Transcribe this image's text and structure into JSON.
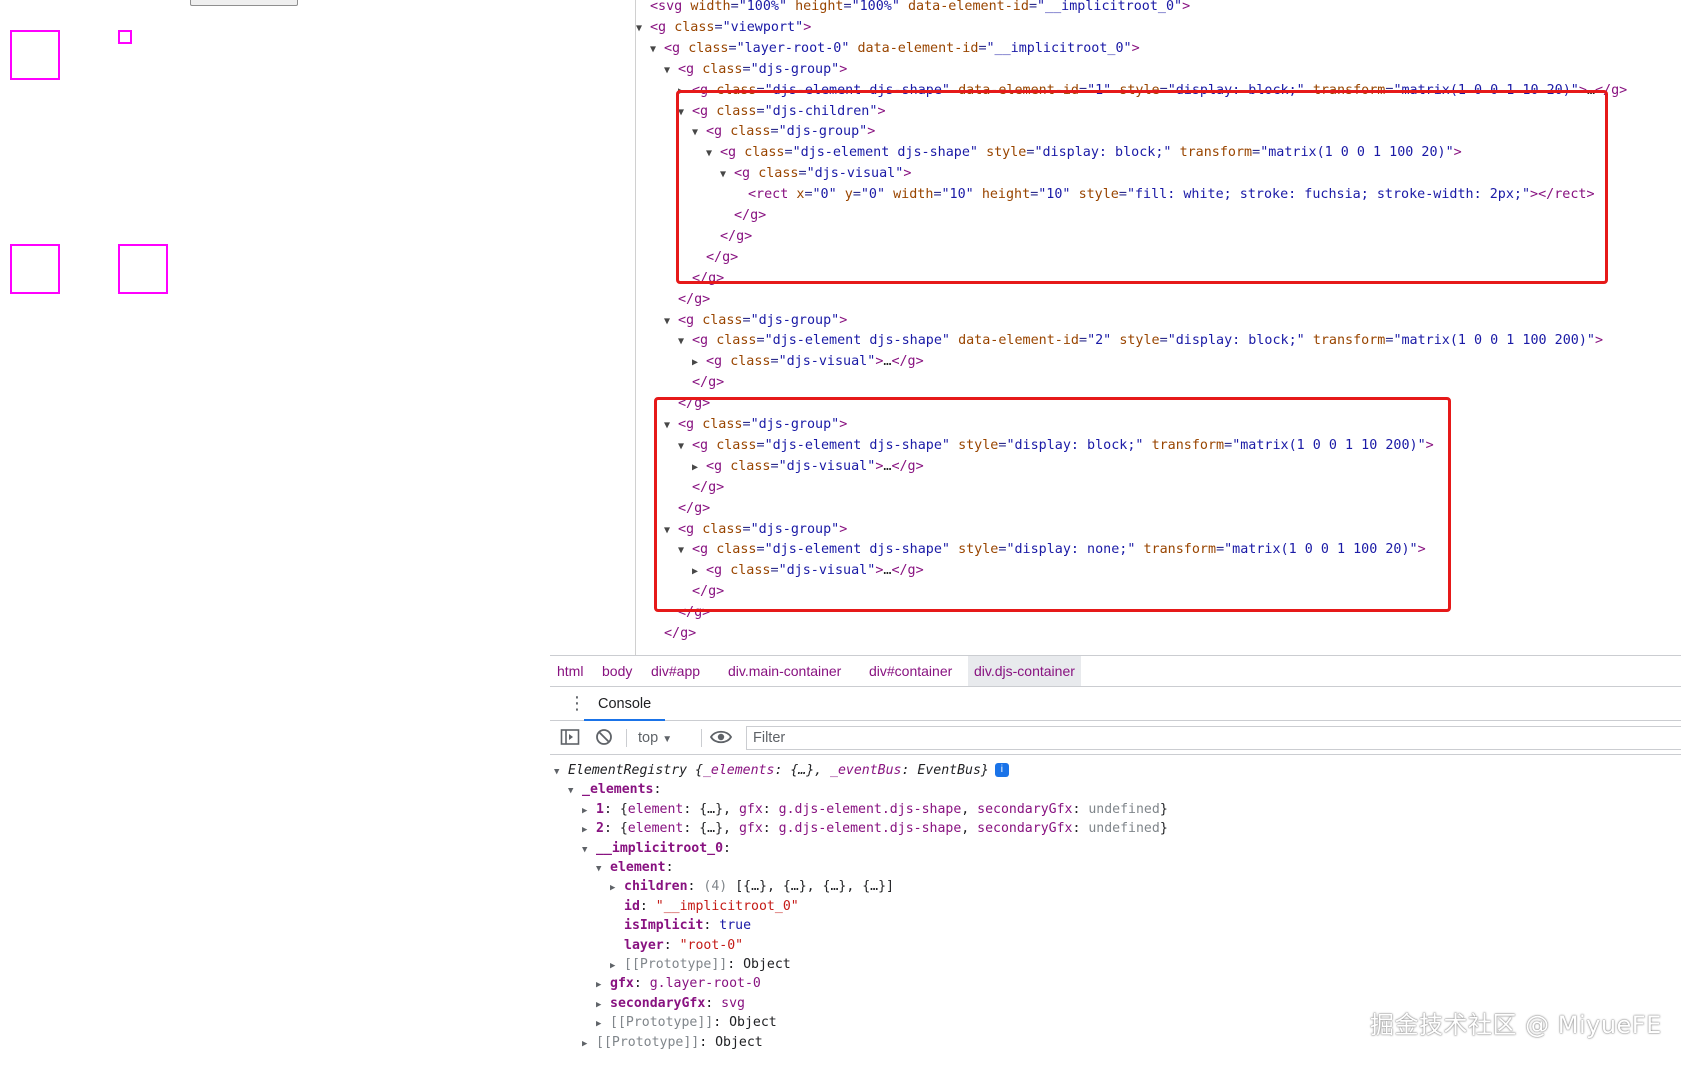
{
  "canvas": {
    "shapes": [
      {
        "name": "shape-square-1"
      },
      {
        "name": "shape-small-square"
      },
      {
        "name": "shape-square-3"
      },
      {
        "name": "shape-square-4"
      }
    ],
    "stroke_color": "#ff00ff"
  },
  "elements_panel": {
    "lines": [
      {
        "d": 0,
        "tri": "",
        "html": "<span class='tag'>&lt;svg</span> <span class='an'>width</span>=<span class='av'>\"100%\"</span> <span class='an'>height</span>=<span class='av'>\"100%\"</span> <span class='an'>data-element-id</span>=<span class='av'>\"__implicitroot_0\"</span><span class='tag'>&gt;</span>"
      },
      {
        "d": 0,
        "tri": "▼",
        "html": "<span class='tag'>&lt;g</span> <span class='an'>class</span>=<span class='av'>\"viewport\"</span><span class='tag'>&gt;</span>"
      },
      {
        "d": 1,
        "tri": "▼",
        "html": "<span class='tag'>&lt;g</span> <span class='an'>class</span>=<span class='av'>\"layer-root-0\"</span> <span class='an'>data-element-id</span>=<span class='av'>\"__implicitroot_0\"</span><span class='tag'>&gt;</span>"
      },
      {
        "d": 2,
        "tri": "▼",
        "html": "<span class='tag'>&lt;g</span> <span class='an'>class</span>=<span class='av'>\"djs-group\"</span><span class='tag'>&gt;</span>"
      },
      {
        "d": 3,
        "tri": "▶",
        "html": "<span class='tag'>&lt;g</span> <span class='an'>class</span>=<span class='av'>\"djs-element djs-shape\"</span> <span class='an'>data-element-id</span>=<span class='av'>\"1\"</span> <span class='an'>style</span>=<span class='av'>\"display: block;\"</span> <span class='an'>transform</span>=<span class='av'>\"matrix(1 0 0 1 10 20)\"</span><span class='tag'>&gt;</span><span class='txt'>…</span><span class='tag'>&lt;/g&gt;</span>"
      },
      {
        "d": 3,
        "tri": "▼",
        "html": "<span class='tag'>&lt;g</span> <span class='an'>class</span>=<span class='av'>\"djs-children\"</span><span class='tag'>&gt;</span>"
      },
      {
        "d": 4,
        "tri": "▼",
        "html": "<span class='tag'>&lt;g</span> <span class='an'>class</span>=<span class='av'>\"djs-group\"</span><span class='tag'>&gt;</span>"
      },
      {
        "d": 5,
        "tri": "▼",
        "html": "<span class='tag'>&lt;g</span> <span class='an'>class</span>=<span class='av'>\"djs-element djs-shape\"</span> <span class='an'>style</span>=<span class='av'>\"display: block;\"</span> <span class='an'>transform</span>=<span class='av'>\"matrix(1 0 0 1 100 20)\"</span><span class='tag'>&gt;</span>"
      },
      {
        "d": 6,
        "tri": "▼",
        "html": "<span class='tag'>&lt;g</span> <span class='an'>class</span>=<span class='av'>\"djs-visual\"</span><span class='tag'>&gt;</span>"
      },
      {
        "d": 7,
        "tri": "",
        "html": "<span class='tag'>&lt;rect</span> <span class='an'>x</span>=<span class='av'>\"0\"</span> <span class='an'>y</span>=<span class='av'>\"0\"</span> <span class='an'>width</span>=<span class='av'>\"10\"</span> <span class='an'>height</span>=<span class='av'>\"10\"</span> <span class='an'>style</span>=<span class='av'>\"fill: white; stroke: fuchsia; stroke-width: 2px;\"</span><span class='tag'>&gt;&lt;/rect&gt;</span>"
      },
      {
        "d": 6,
        "tri": "",
        "html": "<span class='tag'>&lt;/g&gt;</span>"
      },
      {
        "d": 5,
        "tri": "",
        "html": "<span class='tag'>&lt;/g&gt;</span>"
      },
      {
        "d": 4,
        "tri": "",
        "html": "<span class='tag'>&lt;/g&gt;</span>"
      },
      {
        "d": 3,
        "tri": "",
        "html": "<span class='tag'>&lt;/g&gt;</span>"
      },
      {
        "d": 2,
        "tri": "",
        "html": "<span class='tag'>&lt;/g&gt;</span>"
      },
      {
        "d": 2,
        "tri": "▼",
        "html": "<span class='tag'>&lt;g</span> <span class='an'>class</span>=<span class='av'>\"djs-group\"</span><span class='tag'>&gt;</span>"
      },
      {
        "d": 3,
        "tri": "▼",
        "html": "<span class='tag'>&lt;g</span> <span class='an'>class</span>=<span class='av'>\"djs-element djs-shape\"</span> <span class='an'>data-element-id</span>=<span class='av'>\"2\"</span> <span class='an'>style</span>=<span class='av'>\"display: block;\"</span> <span class='an'>transform</span>=<span class='av'>\"matrix(1 0 0 1 100 200)\"</span><span class='tag'>&gt;</span>"
      },
      {
        "d": 4,
        "tri": "▶",
        "html": "<span class='tag'>&lt;g</span> <span class='an'>class</span>=<span class='av'>\"djs-visual\"</span><span class='tag'>&gt;</span><span class='txt'>…</span><span class='tag'>&lt;/g&gt;</span>"
      },
      {
        "d": 3,
        "tri": "",
        "html": "<span class='tag'>&lt;/g&gt;</span>"
      },
      {
        "d": 2,
        "tri": "",
        "html": "<span class='tag'>&lt;/g&gt;</span>"
      },
      {
        "d": 2,
        "tri": "▼",
        "html": "<span class='tag'>&lt;g</span> <span class='an'>class</span>=<span class='av'>\"djs-group\"</span><span class='tag'>&gt;</span>"
      },
      {
        "d": 3,
        "tri": "▼",
        "html": "<span class='tag'>&lt;g</span> <span class='an'>class</span>=<span class='av'>\"djs-element djs-shape\"</span> <span class='an'>style</span>=<span class='av'>\"display: block;\"</span> <span class='an'>transform</span>=<span class='av'>\"matrix(1 0 0 1 10 200)\"</span><span class='tag'>&gt;</span>"
      },
      {
        "d": 4,
        "tri": "▶",
        "html": "<span class='tag'>&lt;g</span> <span class='an'>class</span>=<span class='av'>\"djs-visual\"</span><span class='tag'>&gt;</span><span class='txt'>…</span><span class='tag'>&lt;/g&gt;</span>"
      },
      {
        "d": 3,
        "tri": "",
        "html": "<span class='tag'>&lt;/g&gt;</span>"
      },
      {
        "d": 2,
        "tri": "",
        "html": "<span class='tag'>&lt;/g&gt;</span>"
      },
      {
        "d": 2,
        "tri": "▼",
        "html": "<span class='tag'>&lt;g</span> <span class='an'>class</span>=<span class='av'>\"djs-group\"</span><span class='tag'>&gt;</span>"
      },
      {
        "d": 3,
        "tri": "▼",
        "html": "<span class='tag'>&lt;g</span> <span class='an'>class</span>=<span class='av'>\"djs-element djs-shape\"</span> <span class='an'>style</span>=<span class='av'>\"display: none;\"</span> <span class='an'>transform</span>=<span class='av'>\"matrix(1 0 0 1 100 20)\"</span><span class='tag'>&gt;</span>"
      },
      {
        "d": 4,
        "tri": "▶",
        "html": "<span class='tag'>&lt;g</span> <span class='an'>class</span>=<span class='av'>\"djs-visual\"</span><span class='tag'>&gt;</span><span class='txt'>…</span><span class='tag'>&lt;/g&gt;</span>"
      },
      {
        "d": 3,
        "tri": "",
        "html": "<span class='tag'>&lt;/g&gt;</span>"
      },
      {
        "d": 2,
        "tri": "",
        "html": "<span class='tag'>&lt;/g&gt;</span>"
      },
      {
        "d": 1,
        "tri": "",
        "html": "<span class='tag'>&lt;/g&gt;</span>"
      }
    ],
    "highlight_color": "#e61919"
  },
  "breadcrumbs": [
    "html",
    "body",
    "div#app",
    "div.main-container",
    "div#container",
    "div.djs-container"
  ],
  "drawer": {
    "tab_label": "Console",
    "context_label": "top",
    "filter_placeholder": "Filter"
  },
  "console": {
    "lines": [
      {
        "d": 0,
        "tri": "▼",
        "html": "<span class='it'>ElementRegistry {<span class='keyn'>_elements</span>: {…}, <span class='keyn'>_eventBus</span>: EventBus}</span><span class='info-icon'>i</span>"
      },
      {
        "d": 1,
        "tri": "▼",
        "html": "<span class='key'>_elements</span>:"
      },
      {
        "d": 2,
        "tri": "▶",
        "html": "<span class='key'>1</span>: {<span class='keyn'>element</span>: {…}, <span class='keyn'>gfx</span>: <span class='val-elem'>g.djs-element.djs-shape</span>, <span class='keyn'>secondaryGfx</span>: <span class='val-dim'>undefined</span>}"
      },
      {
        "d": 2,
        "tri": "▶",
        "html": "<span class='key'>2</span>: {<span class='keyn'>element</span>: {…}, <span class='keyn'>gfx</span>: <span class='val-elem'>g.djs-element.djs-shape</span>, <span class='keyn'>secondaryGfx</span>: <span class='val-dim'>undefined</span>}"
      },
      {
        "d": 2,
        "tri": "▼",
        "html": "<span class='key'>__implicitroot_0</span>:"
      },
      {
        "d": 3,
        "tri": "▼",
        "html": "<span class='key'>element</span>:"
      },
      {
        "d": 4,
        "tri": "▶",
        "html": "<span class='key'>children</span>: <span class='val-dim'>(4)</span> [{…}, {…}, {…}, {…}]"
      },
      {
        "d": 4,
        "tri": "",
        "html": "<span class='key'>id</span>: <span class='val-str'>\"__implicitroot_0\"</span>"
      },
      {
        "d": 4,
        "tri": "",
        "html": "<span class='key'>isImplicit</span>: <span class='val-bool'>true</span>"
      },
      {
        "d": 4,
        "tri": "",
        "html": "<span class='key'>layer</span>: <span class='val-str'>\"root-0\"</span>"
      },
      {
        "d": 4,
        "tri": "▶",
        "html": "<span class='val-dim'>[[Prototype]]</span>: Object"
      },
      {
        "d": 3,
        "tri": "▶",
        "html": "<span class='key'>gfx</span>: <span class='val-elem'>g.layer-root-0</span>"
      },
      {
        "d": 3,
        "tri": "▶",
        "html": "<span class='key'>secondaryGfx</span>: <span class='val-elem'>svg</span>"
      },
      {
        "d": 3,
        "tri": "▶",
        "html": "<span class='val-dim'>[[Prototype]]</span>: Object"
      },
      {
        "d": 2,
        "tri": "▶",
        "html": "<span class='val-dim'>[[Prototype]]</span>: Object"
      }
    ]
  },
  "watermark": "掘金技术社区 @ MiyueFE"
}
